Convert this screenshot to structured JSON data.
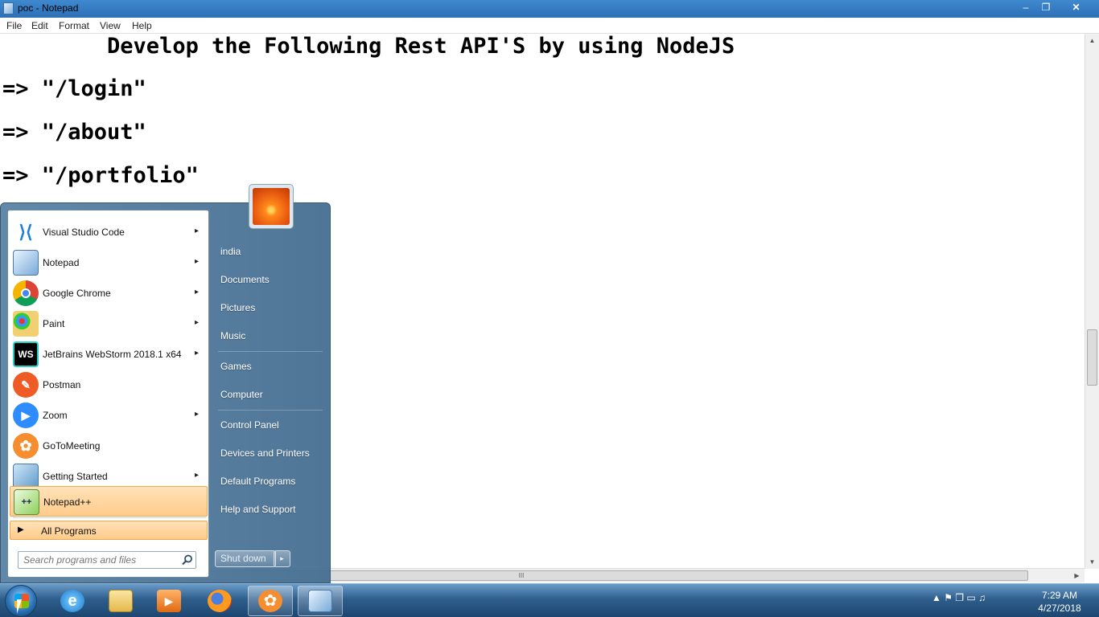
{
  "window": {
    "title": "poc - Notepad",
    "minimize": "–",
    "maximize": "❐",
    "close": "✕"
  },
  "menu": [
    "File",
    "Edit",
    "Format",
    "View",
    "Help"
  ],
  "editor": {
    "lines": [
      "        Develop the Following Rest API'S by using NodeJS",
      "=> \"/login\"",
      "=> \"/about\"",
      "=> \"/portfolio\""
    ]
  },
  "startmenu": {
    "programs": [
      {
        "label": "Visual Studio Code",
        "icon": "vscode-icon",
        "arrow": "▸"
      },
      {
        "label": "Notepad",
        "icon": "notepad-icon",
        "arrow": "▸"
      },
      {
        "label": "Google Chrome",
        "icon": "chrome-icon",
        "arrow": "▸"
      },
      {
        "label": "Paint",
        "icon": "paint-icon",
        "arrow": "▸"
      },
      {
        "label": "JetBrains WebStorm 2018.1 x64",
        "icon": "webstorm-icon",
        "arrow": "▸"
      },
      {
        "label": "Postman",
        "icon": "postman-icon",
        "arrow": ""
      },
      {
        "label": "Zoom",
        "icon": "zoom-icon",
        "arrow": "▸"
      },
      {
        "label": "GoToMeeting",
        "icon": "gotomeeting-icon",
        "arrow": ""
      },
      {
        "label": "Getting Started",
        "icon": "getting-started-icon",
        "arrow": "▸"
      },
      {
        "label": "Notepad++",
        "icon": "notepadpp-icon",
        "arrow": ""
      }
    ],
    "all_programs": "All Programs",
    "search_placeholder": "Search programs and files",
    "right_items": [
      "india",
      "Documents",
      "Pictures",
      "Music",
      "Games",
      "Computer",
      "Control Panel",
      "Devices and Printers",
      "Default Programs",
      "Help and Support"
    ],
    "shutdown": "Shut down",
    "shutdown_arrow": "▸"
  },
  "scroll": {
    "thumb_grip": "III"
  },
  "taskbar": {
    "apps": [
      "internet-explorer-icon",
      "file-explorer-icon",
      "media-player-icon",
      "firefox-icon",
      "gotomeeting-icon",
      "notepad-icon"
    ],
    "tray_icons": "▲  ⚑  ❐  ▭  ♫",
    "time": "7:29 AM",
    "date": "4/27/2018"
  }
}
